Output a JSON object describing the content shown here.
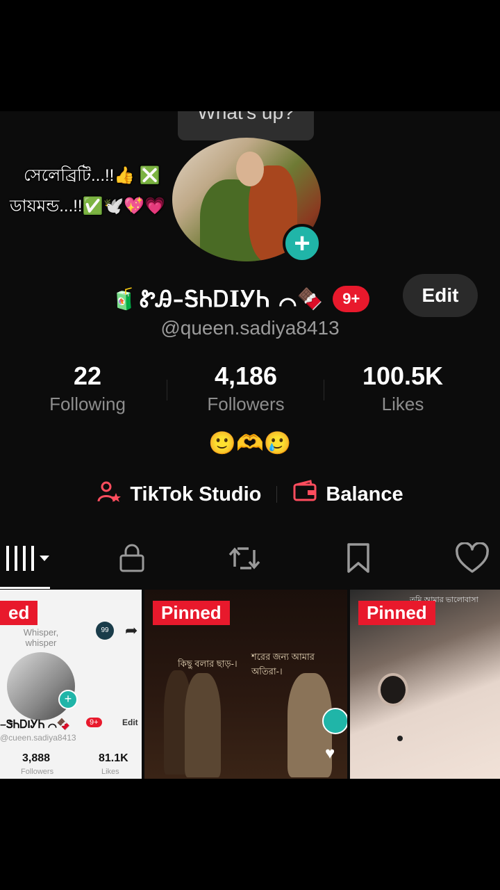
{
  "bubble": {
    "text": "What's up?"
  },
  "overlay": {
    "line1": "সেলেব্রিটি...!!👍 ❎",
    "line2": "ডায়মন্ড...!!✅🕊️💖💗"
  },
  "profile": {
    "name_icon": "🧃",
    "name": "ᏑᎯ–ᎦᏂᎠIᎩᏂ ⌒",
    "name_suffix": "🍫",
    "badge": "9+",
    "edit_label": "Edit",
    "handle": "@queen.sadiya8413"
  },
  "stats": [
    {
      "value": "22",
      "label": "Following"
    },
    {
      "value": "4,186",
      "label": "Followers"
    },
    {
      "value": "100.5K",
      "label": "Likes"
    }
  ],
  "bio": "🙂🫶🥲",
  "tools": {
    "studio_label": "TikTok Studio",
    "balance_label": "Balance"
  },
  "tabs": [
    "grid-icon",
    "lock-icon",
    "repost-icon",
    "bookmark-icon",
    "heart-icon"
  ],
  "videos": [
    {
      "pinned": "ed",
      "bubble": "Whisper, whisper",
      "mini_badge": "99",
      "mini_name": "–ᏕᏂᎠIᎩᏂ ⌒🍫",
      "mini_badge2": "9+",
      "mini_edit": "Edit",
      "mini_handle": "@cueen.sadiya8413",
      "mini_followers": "3,888",
      "mini_followers_label": "Followers",
      "mini_likes": "81.1K",
      "mini_likes_label": "Likes"
    },
    {
      "pinned": "Pinned",
      "caption_left": "কিছু বলার ছাড়-।",
      "caption_right": "শরের জন্য আমার অতিরা-।"
    },
    {
      "pinned": "Pinned",
      "caption": "তুমি আমার ভালোবাসা"
    }
  ],
  "colors": {
    "accent_red": "#e8192c",
    "teal": "#20b5a8",
    "bg": "#0c0c0c"
  }
}
